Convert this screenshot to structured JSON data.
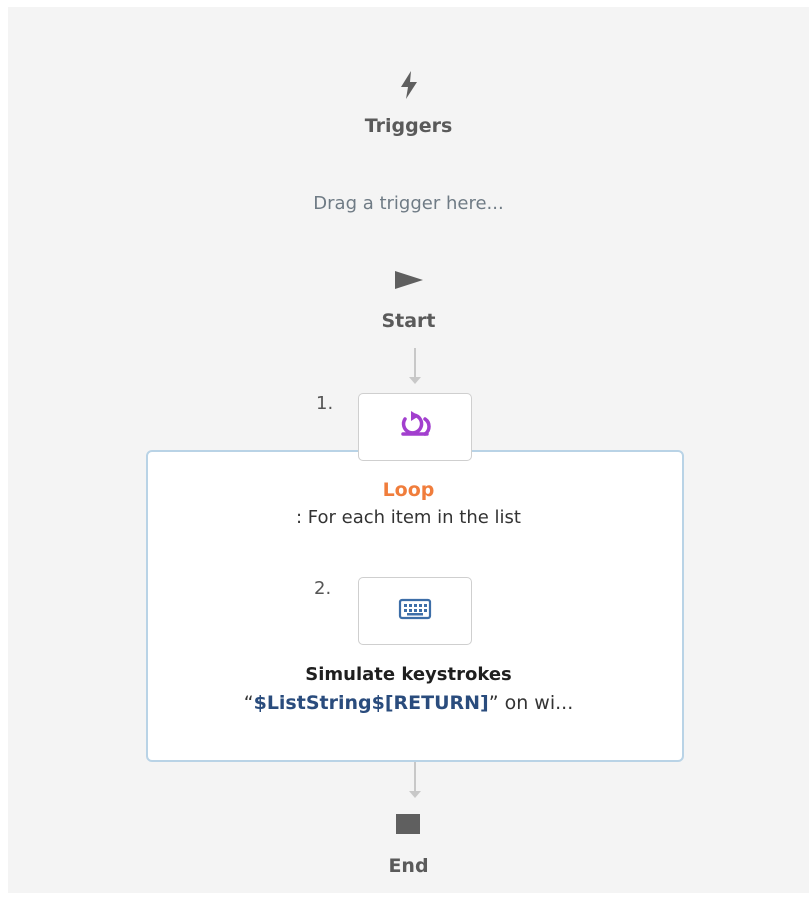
{
  "triggers": {
    "icon": "lightning-icon",
    "label": "Triggers",
    "drop_hint": "Drag a trigger here..."
  },
  "start": {
    "icon": "play-triangle-icon",
    "label": "Start"
  },
  "steps": [
    {
      "number": "1.",
      "icon": "loop-icon",
      "title": "Loop",
      "description": ": For each item in the list"
    },
    {
      "number": "2.",
      "icon": "keyboard-icon",
      "title": "Simulate keystrokes",
      "description_prefix": "“",
      "description_var": "$ListString$[RETURN]",
      "description_suffix": "” on wi..."
    }
  ],
  "end": {
    "icon": "stop-square-icon",
    "label": "End"
  },
  "colors": {
    "loop_accent": "#f07d3c",
    "loop_icon": "#a23fce",
    "container_border": "#b9d3e6",
    "variable_text": "#2a4c7d",
    "keyboard_icon": "#3d6ea8"
  }
}
